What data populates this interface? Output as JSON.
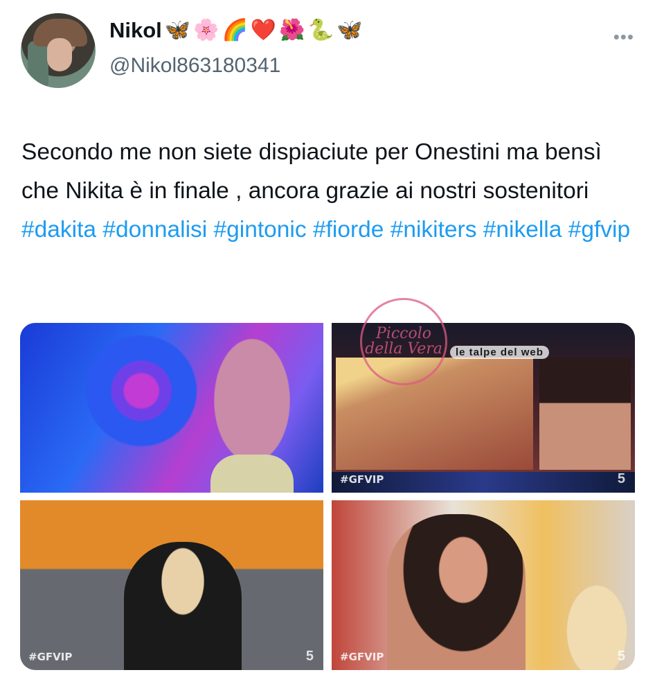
{
  "tweet": {
    "author_name": "Nikol",
    "author_emojis": [
      "🦋",
      "🌸",
      "🌈",
      "❤️",
      "🌺",
      "🐍",
      "🦋"
    ],
    "handle": "@Nikol863180341",
    "more_label": "•••",
    "text_segments": [
      {
        "text": "Secondo me non siete dispiaciute per Onestini ma bensì che Nikita è in finale , ancora grazie ai nostri sostenitori ",
        "hashtag": false
      },
      {
        "text": "#dakita",
        "hashtag": true
      },
      {
        "text": " ",
        "hashtag": false
      },
      {
        "text": "#donnalisi",
        "hashtag": true
      },
      {
        "text": " ",
        "hashtag": false
      },
      {
        "text": "#gintonic",
        "hashtag": true
      },
      {
        "text": " ",
        "hashtag": false
      },
      {
        "text": "#fiorde",
        "hashtag": true
      },
      {
        "text": " ",
        "hashtag": false
      },
      {
        "text": "#nikiters",
        "hashtag": true
      },
      {
        "text": " ",
        "hashtag": false
      },
      {
        "text": "#nikella",
        "hashtag": true
      },
      {
        "text": " ",
        "hashtag": false
      },
      {
        "text": "#gfvip",
        "hashtag": true
      }
    ]
  },
  "media": {
    "tags": {
      "tile2": "#GFVIP",
      "tile3": "#GFVIP",
      "tile4": "#GFVIP"
    },
    "channel_logo": "5",
    "watermark_text": "le talpe del web",
    "stamp_text": "Piccolo della Vera"
  },
  "colors": {
    "hashtag": "#1d9bf0",
    "handle": "#536471",
    "text": "#0f1419"
  }
}
